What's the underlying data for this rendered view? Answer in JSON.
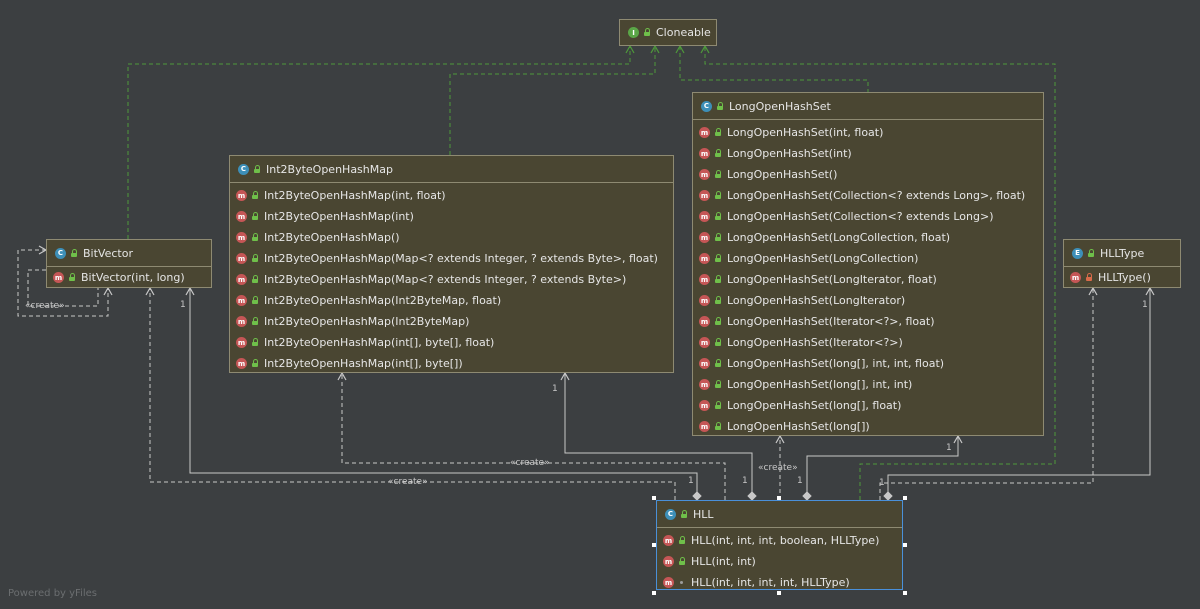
{
  "diagram": {
    "nodes": {
      "cloneable": {
        "name": "Cloneable",
        "kind": "I"
      },
      "long_open_hash_set": {
        "name": "LongOpenHashSet",
        "kind": "C",
        "methods": [
          "LongOpenHashSet(int, float)",
          "LongOpenHashSet(int)",
          "LongOpenHashSet()",
          "LongOpenHashSet(Collection<? extends Long>, float)",
          "LongOpenHashSet(Collection<? extends Long>)",
          "LongOpenHashSet(LongCollection, float)",
          "LongOpenHashSet(LongCollection)",
          "LongOpenHashSet(LongIterator, float)",
          "LongOpenHashSet(LongIterator)",
          "LongOpenHashSet(Iterator<?>, float)",
          "LongOpenHashSet(Iterator<?>)",
          "LongOpenHashSet(long[], int, int, float)",
          "LongOpenHashSet(long[], int, int)",
          "LongOpenHashSet(long[], float)",
          "LongOpenHashSet(long[])"
        ]
      },
      "int2byte_open_hash_map": {
        "name": "Int2ByteOpenHashMap",
        "kind": "C",
        "methods": [
          "Int2ByteOpenHashMap(int, float)",
          "Int2ByteOpenHashMap(int)",
          "Int2ByteOpenHashMap()",
          "Int2ByteOpenHashMap(Map<? extends Integer, ? extends Byte>, float)",
          "Int2ByteOpenHashMap(Map<? extends Integer, ? extends Byte>)",
          "Int2ByteOpenHashMap(Int2ByteMap, float)",
          "Int2ByteOpenHashMap(Int2ByteMap)",
          "Int2ByteOpenHashMap(int[], byte[], float)",
          "Int2ByteOpenHashMap(int[], byte[])"
        ]
      },
      "bit_vector": {
        "name": "BitVector",
        "kind": "C",
        "methods": [
          "BitVector(int, long)"
        ]
      },
      "hll_type": {
        "name": "HLLType",
        "kind": "E",
        "methods": [
          "HLLType()"
        ]
      },
      "hll": {
        "name": "HLL",
        "kind": "C",
        "methods": [
          "HLL(int, int, int, boolean, HLLType)",
          "HLL(int, int)",
          "HLL(int, int, int, int, HLLType)"
        ]
      }
    },
    "labels": {
      "create": "«create»",
      "one": "1"
    },
    "watermark": "Powered by yFiles"
  },
  "colors": {
    "background": "#3c3f41",
    "node_fill": "#4a4632",
    "node_border": "#8e8a72",
    "selected_border": "#4a90d9",
    "inherit_edge": "#4e9a3a",
    "dep_edge": "#c8c8c8",
    "method_badge": "#c55656",
    "class_badge": "#3d8fb8",
    "interface_badge": "#5aa647"
  }
}
